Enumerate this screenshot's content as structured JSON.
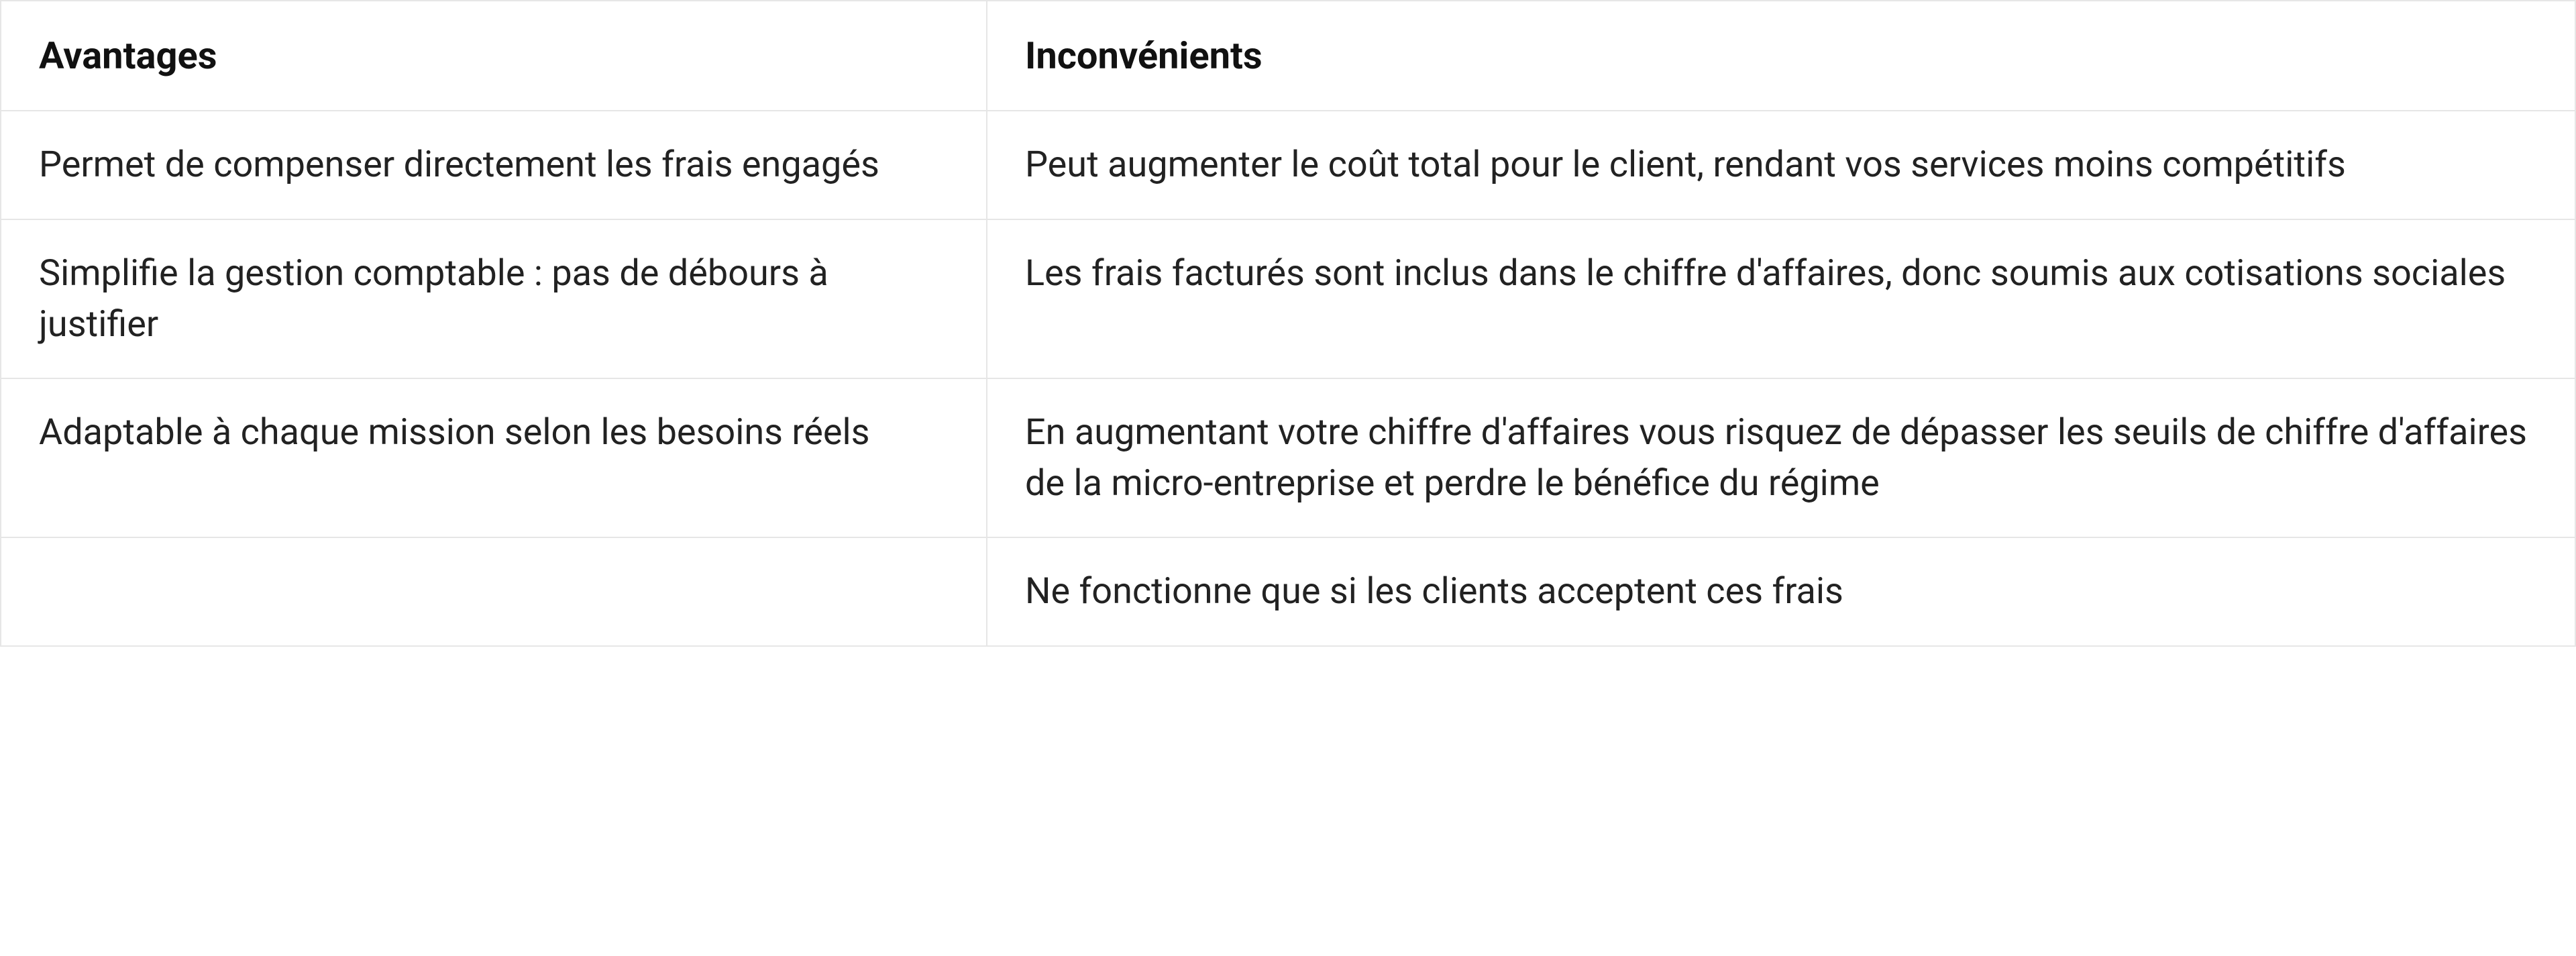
{
  "table": {
    "headers": {
      "advantages": "Avantages",
      "disadvantages": "Inconvénients"
    },
    "rows": [
      {
        "advantage": "Permet de compenser directement les frais engagés",
        "disadvantage": "Peut augmenter le coût total pour le client, rendant vos services moins compétitifs"
      },
      {
        "advantage": "Simplifie la gestion comptable : pas de débours à justifier",
        "disadvantage": "Les frais facturés sont inclus dans le chiffre d'affaires, donc soumis aux cotisations sociales"
      },
      {
        "advantage": "Adaptable à chaque mission selon les besoins réels",
        "disadvantage": "En augmentant votre chiffre d'affaires vous risquez de dépasser les seuils de chiffre d'affaires de la micro-entreprise et perdre le bénéfice du régime"
      },
      {
        "advantage": "",
        "disadvantage": "Ne fonctionne que si les clients acceptent ces frais"
      }
    ]
  }
}
